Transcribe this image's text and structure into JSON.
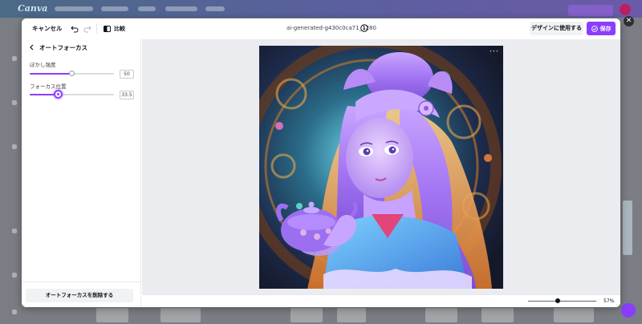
{
  "header": {
    "cancel_label": "キャンセル",
    "compare_label": "比較",
    "file_name": "ai-generated-g430c0ca71_1280",
    "use_in_design_label": "デザインに使用する",
    "save_label": "保存"
  },
  "panel": {
    "title": "オートフォーカス",
    "blur_strength": {
      "label": "ぼかし強度",
      "value": "50",
      "fraction": 0.5
    },
    "focus_position": {
      "label": "フォーカス位置",
      "value": "33.5",
      "fraction": 0.335
    },
    "remove_button_label": "オートフォーカスを削除する"
  },
  "footer": {
    "zoom_label": "57%",
    "zoom_fraction": 0.43
  },
  "colors": {
    "accent": "#8b3dff"
  },
  "icons": [
    "back-arrow-icon",
    "undo-icon",
    "redo-icon",
    "compare-icon",
    "info-icon",
    "save-check-icon",
    "close-icon"
  ]
}
